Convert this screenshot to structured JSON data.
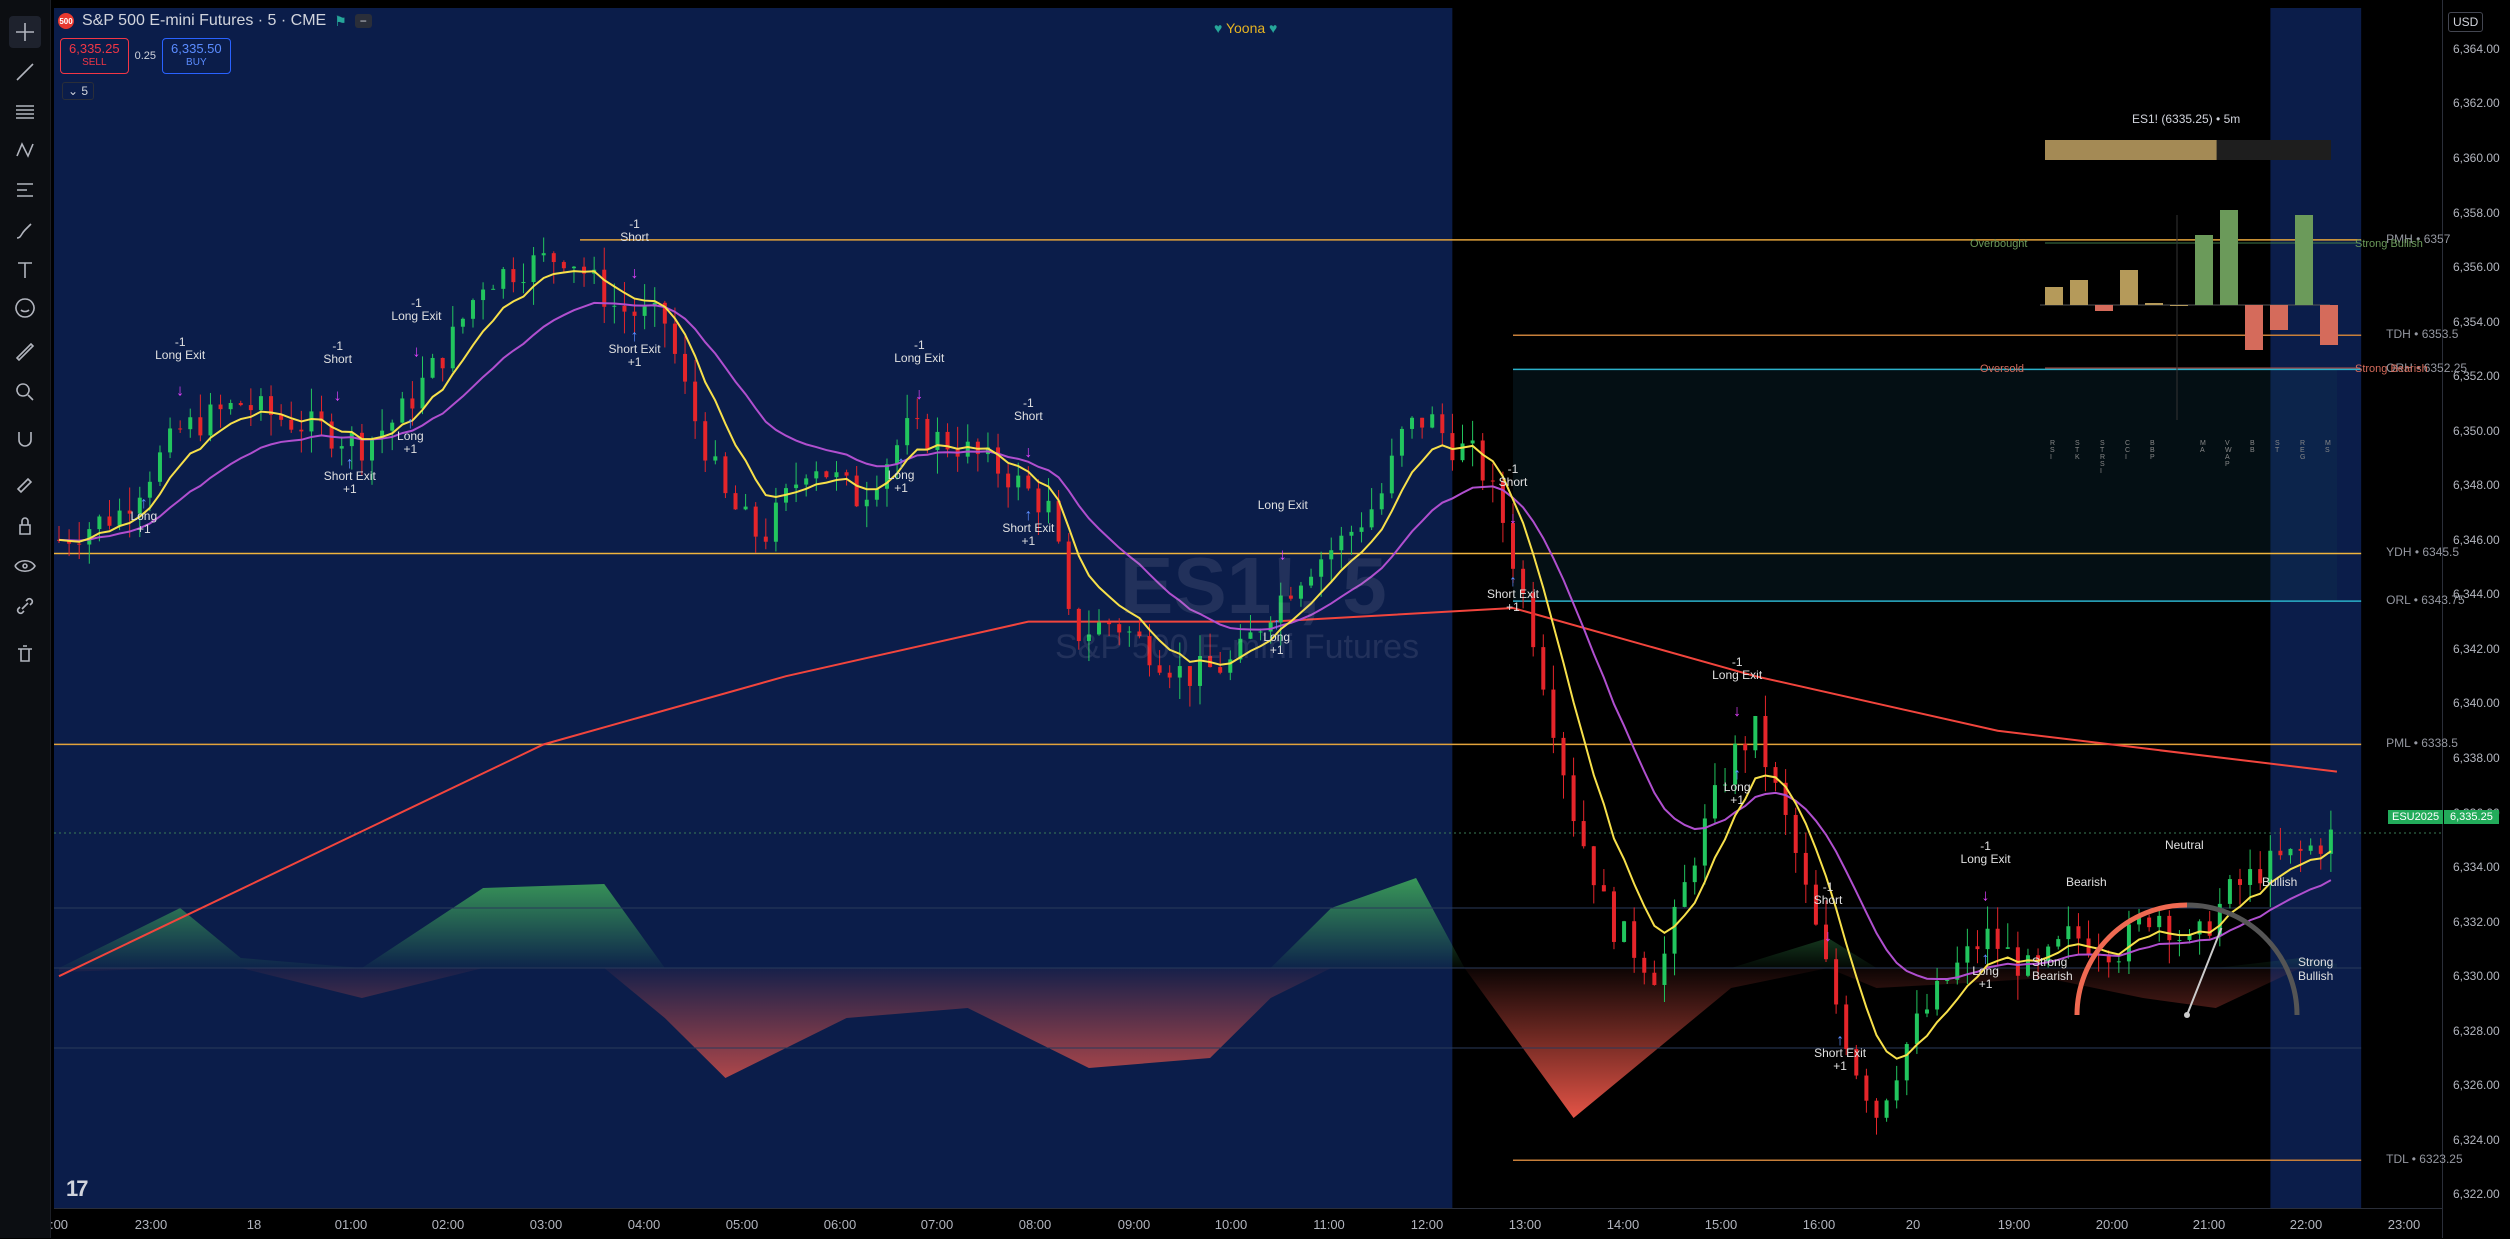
{
  "toolbar": {
    "tools": [
      "crosshair-icon",
      "trend-line-icon",
      "fib-icon",
      "pattern-icon",
      "projection-icon",
      "brush-icon",
      "text-icon",
      "emoji-icon",
      "ruler-icon",
      "zoom-icon",
      "magnet-icon",
      "lock-drawing-icon",
      "lock-icon",
      "eye-icon",
      "link-icon",
      "trash-icon"
    ]
  },
  "header": {
    "symbol_badge": "500",
    "title": "S&P 500 E-mini Futures · 5 · CME",
    "sell_price": "6,335.25",
    "sell_label": "SELL",
    "spread": "0.25",
    "buy_price": "6,335.50",
    "buy_label": "BUY",
    "interval": "5"
  },
  "overlay": {
    "yoona": "Yoona",
    "watermark": "ES1!, 5",
    "watermark_sub": "S&P 500 E-mini Futures",
    "tv_logo": "17"
  },
  "price_axis": {
    "currency": "USD",
    "ticks": [
      "6,364.00",
      "6,362.00",
      "6,360.00",
      "6,358.00",
      "6,356.00",
      "6,354.00",
      "6,352.00",
      "6,350.00",
      "6,348.00",
      "6,346.00",
      "6,344.00",
      "6,342.00",
      "6,340.00",
      "6,338.00",
      "6,336.00",
      "6,334.00",
      "6,332.00",
      "6,330.00",
      "6,328.00",
      "6,326.00",
      "6,324.00",
      "6,322.00"
    ],
    "current_symbol": "ESU2025",
    "current_price": "6,335.25"
  },
  "time_axis": {
    "ticks": [
      ":00",
      "23:00",
      "18",
      "01:00",
      "02:00",
      "03:00",
      "04:00",
      "05:00",
      "06:00",
      "07:00",
      "08:00",
      "09:00",
      "10:00",
      "11:00",
      "12:00",
      "13:00",
      "14:00",
      "15:00",
      "16:00",
      "20",
      "19:00",
      "20:00",
      "21:00",
      "22:00",
      "23:00"
    ]
  },
  "levels": [
    {
      "label": "PMH • 6357",
      "price": 6357,
      "color": "#e3a33b"
    },
    {
      "label": "TDH • 6353.5",
      "price": 6353.5,
      "color": "#c77f3a"
    },
    {
      "label": "ORH • 6352.25",
      "price": 6352.25,
      "color": "#2bb0c9"
    },
    {
      "label": "YDH • 6345.5",
      "price": 6345.5,
      "color": "#f0b43c"
    },
    {
      "label": "ORL • 6343.75",
      "price": 6343.75,
      "color": "#2bb0c9"
    },
    {
      "label": "PML • 6338.5",
      "price": 6338.5,
      "color": "#e3a33b"
    },
    {
      "label": "TDL • 6323.25",
      "price": 6323.25,
      "color": "#c77f3a"
    }
  ],
  "signals": [
    {
      "text": "-1\nLong Exit",
      "time": 23.0,
      "above": true
    },
    {
      "text": "-1\nShort",
      "time": 0.3,
      "above": true
    },
    {
      "text": "-1\nLong Exit",
      "time": 0.95,
      "above": true
    },
    {
      "text": "Long\n+1",
      "time": 22.7,
      "above": false
    },
    {
      "text": "Short Exit\n+1",
      "time": 0.4,
      "above": false
    },
    {
      "text": "Long\n+1",
      "time": 0.9,
      "above": false
    },
    {
      "text": "-1\nShort",
      "time": 2.75,
      "above": true
    },
    {
      "text": "Short Exit\n+1",
      "time": 2.75,
      "above": false
    },
    {
      "text": "-1\nLong Exit",
      "time": 5.1,
      "above": true
    },
    {
      "text": "-1\nShort",
      "time": 6.0,
      "above": true
    },
    {
      "text": "Long\n+1",
      "time": 4.95,
      "above": false
    },
    {
      "text": "Short Exit\n+1",
      "time": 6.0,
      "above": false
    },
    {
      "text": "Long Exit",
      "time": 8.1,
      "above": true
    },
    {
      "text": "Long\n+1",
      "time": 8.05,
      "above": false
    },
    {
      "text": "-1\nShort",
      "time": 10.0,
      "above": true
    },
    {
      "text": "Short Exit\n+1",
      "time": 10.0,
      "above": false
    },
    {
      "text": "-1\nLong Exit",
      "time": 11.85,
      "above": true
    },
    {
      "text": "Long\n+1",
      "time": 11.85,
      "above": false
    },
    {
      "text": "-1\nShort",
      "time": 12.6,
      "above": true
    },
    {
      "text": "Short Exit\n+1",
      "time": 12.7,
      "above": false
    },
    {
      "text": "-1\nLong Exit",
      "time": 13.9,
      "above": true
    },
    {
      "text": "Long\n+1",
      "time": 13.9,
      "above": false
    }
  ],
  "panel": {
    "title": "ES1! (6335.25) • 5m",
    "overbought": "Overbought",
    "oversold": "Oversold",
    "strong_bullish": "Strong Bullish",
    "strong_bearish": "Strong Bearish",
    "bar_labels": [
      "RSI",
      "STK",
      "STRSI",
      "CCI",
      "BBP",
      "MA",
      "VWAP",
      "BB",
      "ST",
      "REG",
      "MS"
    ],
    "progress": 0.6,
    "bars": [
      18,
      25,
      -6,
      35,
      2,
      0,
      70,
      95,
      -45,
      -25,
      90,
      -40
    ],
    "colors": {
      "bull": "#6b9a5a",
      "bear": "#d56b5b",
      "neutral": "#b59a5a"
    }
  },
  "gauge": {
    "neutral": "Neutral",
    "bearish": "Bearish",
    "bullish": "Bullish",
    "strong_bearish": "Strong\nBearish",
    "strong_bullish": "Strong\nBullish",
    "value": 0.62
  },
  "chart_data": {
    "type": "candlestick",
    "title": "S&P 500 E-mini Futures · 5 · CME",
    "ylim": [
      6321.5,
      6365.5
    ],
    "x_range_hours": [
      22.0,
      24.0
    ],
    "session_break_hour": 9.5,
    "close_path": [
      [
        22.0,
        6346.0
      ],
      [
        22.5,
        6347.0
      ],
      [
        23.0,
        6350.0
      ],
      [
        23.5,
        6351.0
      ],
      [
        23.8,
        6350.5
      ],
      [
        0.2,
        6350.0
      ],
      [
        0.5,
        6349.5
      ],
      [
        0.8,
        6350.5
      ],
      [
        1.2,
        6353.0
      ],
      [
        1.5,
        6355.5
      ],
      [
        1.8,
        6356.0
      ],
      [
        2.2,
        6356.5
      ],
      [
        2.6,
        6354.5
      ],
      [
        3.0,
        6354.0
      ],
      [
        3.2,
        6351.0
      ],
      [
        3.5,
        6347.5
      ],
      [
        3.8,
        6346.0
      ],
      [
        4.2,
        6349.0
      ],
      [
        4.6,
        6347.5
      ],
      [
        5.0,
        6350.0
      ],
      [
        5.4,
        6349.5
      ],
      [
        5.8,
        6348.5
      ],
      [
        6.2,
        6347.0
      ],
      [
        6.35,
        6342.5
      ],
      [
        6.7,
        6343.0
      ],
      [
        7.0,
        6342.0
      ],
      [
        7.3,
        6341.0
      ],
      [
        7.7,
        6341.5
      ],
      [
        8.0,
        6343.5
      ],
      [
        8.3,
        6345.0
      ],
      [
        8.6,
        6346.0
      ],
      [
        8.9,
        6347.5
      ],
      [
        9.1,
        6350.0
      ],
      [
        9.3,
        6350.5
      ],
      [
        9.5,
        6349.5
      ],
      [
        9.7,
        6349.0
      ],
      [
        9.9,
        6347.0
      ],
      [
        10.2,
        6342.0
      ],
      [
        10.5,
        6336.0
      ],
      [
        10.8,
        6332.0
      ],
      [
        11.2,
        6330.0
      ],
      [
        11.5,
        6334.5
      ],
      [
        11.8,
        6338.0
      ],
      [
        12.0,
        6339.0
      ],
      [
        12.3,
        6335.0
      ],
      [
        12.6,
        6330.0
      ],
      [
        12.8,
        6327.0
      ],
      [
        13.0,
        6325.0
      ],
      [
        13.3,
        6328.0
      ],
      [
        13.6,
        6330.0
      ],
      [
        13.9,
        6331.5
      ],
      [
        14.3,
        6330.0
      ],
      [
        14.6,
        6331.5
      ],
      [
        15.0,
        6331.0
      ],
      [
        15.3,
        6332.5
      ],
      [
        15.6,
        6331.0
      ],
      [
        15.9,
        6333.0
      ],
      [
        16.2,
        6334.0
      ],
      [
        16.5,
        6334.5
      ],
      [
        16.8,
        6335.25
      ]
    ],
    "ema_slow": [
      [
        22.0,
        6330.0
      ],
      [
        2.0,
        6338.5
      ],
      [
        4.0,
        6341.0
      ],
      [
        6.0,
        6343.0
      ],
      [
        8.0,
        6343.0
      ],
      [
        10.0,
        6343.5
      ],
      [
        12.0,
        6341.0
      ],
      [
        14.0,
        6339.0
      ],
      [
        16.8,
        6337.5
      ]
    ],
    "oscillator": [
      [
        22.0,
        -2
      ],
      [
        23.0,
        30
      ],
      [
        23.5,
        5
      ],
      [
        0.5,
        -15
      ],
      [
        1.5,
        40
      ],
      [
        2.5,
        42
      ],
      [
        3.0,
        -25
      ],
      [
        3.5,
        -55
      ],
      [
        4.5,
        -25
      ],
      [
        5.5,
        -20
      ],
      [
        6.5,
        -50
      ],
      [
        7.5,
        -45
      ],
      [
        8.0,
        -15
      ],
      [
        8.5,
        30
      ],
      [
        9.2,
        45
      ],
      [
        9.6,
        0
      ],
      [
        10.5,
        -75
      ],
      [
        11.2,
        -40
      ],
      [
        11.8,
        -10
      ],
      [
        12.6,
        15
      ],
      [
        13.0,
        -10
      ],
      [
        13.6,
        -8
      ],
      [
        14.4,
        -5
      ],
      [
        15.2,
        -15
      ],
      [
        15.8,
        -20
      ],
      [
        16.5,
        5
      ],
      [
        16.8,
        2
      ]
    ]
  }
}
